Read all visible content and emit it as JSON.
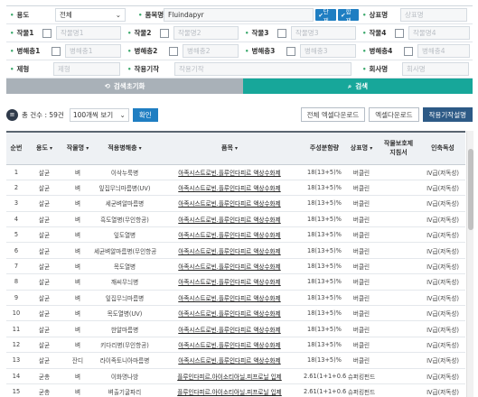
{
  "search": {
    "row1": {
      "usage_label": "용도",
      "usage_value": "전체",
      "product_label": "품목명",
      "product_value": "Fluindapyr",
      "btn_single": "단제",
      "btn_mix": "합제",
      "brand_label": "상표명",
      "brand_placeholder": "상표명"
    },
    "crops": [
      {
        "label": "작물1",
        "placeholder": "작물명1"
      },
      {
        "label": "작물2",
        "placeholder": "작물명2"
      },
      {
        "label": "작물3",
        "placeholder": "작물명3"
      },
      {
        "label": "작물4",
        "placeholder": "작물명4"
      }
    ],
    "pests": [
      {
        "label": "병해충1",
        "placeholder": "병해충1"
      },
      {
        "label": "병해충2",
        "placeholder": "병해충2"
      },
      {
        "label": "병해충3",
        "placeholder": "병해충3"
      },
      {
        "label": "병해충4",
        "placeholder": "병해충4"
      }
    ],
    "row4": {
      "form_label": "제형",
      "form_placeholder": "제형",
      "timing_label": "작용기작",
      "timing_placeholder": "작용기작",
      "company_label": "회사명",
      "company_placeholder": "회사명"
    }
  },
  "actions": {
    "reset": "검색초기화",
    "search": "검색"
  },
  "toolbar": {
    "total": "총 건수 : 59건",
    "page_size": "100개씩 보기",
    "ok": "확인",
    "excel_all": "전체 엑셀다운로드",
    "excel": "엑셀다운로드",
    "mech": "작용기작설명"
  },
  "table": {
    "headers": [
      "순번",
      "용도",
      "작물명",
      "적용병해충",
      "품목",
      "주성분함량",
      "상표명",
      "작물보호제\n지침서",
      "인축독성"
    ],
    "rows": [
      [
        "1",
        "살균",
        "벼",
        "이삭누룩병",
        "아족시스트로빈.플루인다피르 액상수화제",
        "18(13+5)%",
        "버클린",
        "",
        "IV급(저독성)"
      ],
      [
        "2",
        "살균",
        "벼",
        "잎집무늬마름병(UV)",
        "아족시스트로빈.플루인다피르 액상수화제",
        "18(13+5)%",
        "버클린",
        "",
        "IV급(저독성)"
      ],
      [
        "3",
        "살균",
        "벼",
        "세균벼알마름병",
        "아족시스트로빈.플루인다피르 액상수화제",
        "18(13+5)%",
        "버클린",
        "",
        "IV급(저독성)"
      ],
      [
        "4",
        "살균",
        "벼",
        "흑도열병(무인항공)",
        "아족시스트로빈.플루인다피르 액상수화제",
        "18(13+5)%",
        "버클린",
        "",
        "IV급(저독성)"
      ],
      [
        "5",
        "살균",
        "벼",
        "잎도열병",
        "아족시스트로빈.플루인다피르 액상수화제",
        "18(13+5)%",
        "버클린",
        "",
        "IV급(저독성)"
      ],
      [
        "6",
        "살균",
        "벼",
        "세균벼알마름병(무인항공)",
        "아족시스트로빈.플루인다피르 액상수화제",
        "18(13+5)%",
        "버클린",
        "",
        "IV급(저독성)"
      ],
      [
        "7",
        "살균",
        "벼",
        "목도열병",
        "아족시스트로빈.플루인다피르 액상수화제",
        "18(13+5)%",
        "버클린",
        "",
        "IV급(저독성)"
      ],
      [
        "8",
        "살균",
        "벼",
        "깨씨무늬병",
        "아족시스트로빈.플루인다피르 액상수화제",
        "18(13+5)%",
        "버클린",
        "",
        "IV급(저독성)"
      ],
      [
        "9",
        "살균",
        "벼",
        "잎집무늬마름병",
        "아족시스트로빈.플루인다피르 액상수화제",
        "18(13+5)%",
        "버클린",
        "",
        "IV급(저독성)"
      ],
      [
        "10",
        "살균",
        "벼",
        "목도열병(UV)",
        "아족시스트로빈.플루인다피르 액상수화제",
        "18(13+5)%",
        "버클린",
        "",
        "IV급(저독성)"
      ],
      [
        "11",
        "살균",
        "벼",
        "한알마름병",
        "아족시스트로빈.플루인다피르 액상수화제",
        "18(13+5)%",
        "버클린",
        "",
        "IV급(저독성)"
      ],
      [
        "12",
        "살균",
        "벼",
        "키다리병(무인항공)",
        "아족시스트로빈.플루인다피르 액상수화제",
        "18(13+5)%",
        "버클린",
        "",
        "IV급(저독성)"
      ],
      [
        "13",
        "살균",
        "잔디",
        "라이족토니아마름병",
        "아족시스트로빈.플루인다피르 액상수화제",
        "18(13+5)%",
        "버클린",
        "",
        "IV급(저독성)"
      ],
      [
        "14",
        "균총",
        "벼",
        "이화명나방",
        "플루인다피르.아이소티아닐.피프로닐 입제",
        "2.61(1+1+0.6)%",
        "슈퍼킹펀드",
        "",
        "IV급(저독성)"
      ],
      [
        "15",
        "균총",
        "벼",
        "벼출기굴파리",
        "플루인다피르.아이소티아닐.피프로닐 입제",
        "2.61(1+1+0.6)%",
        "슈퍼킹펀드",
        "",
        "IV급(저독성)"
      ]
    ]
  },
  "colors": {
    "accent_blue": "#1f7ec2",
    "accent_teal": "#17a79a",
    "dot_green": "#3aa86b",
    "reset_gray": "#a9b1b8"
  }
}
